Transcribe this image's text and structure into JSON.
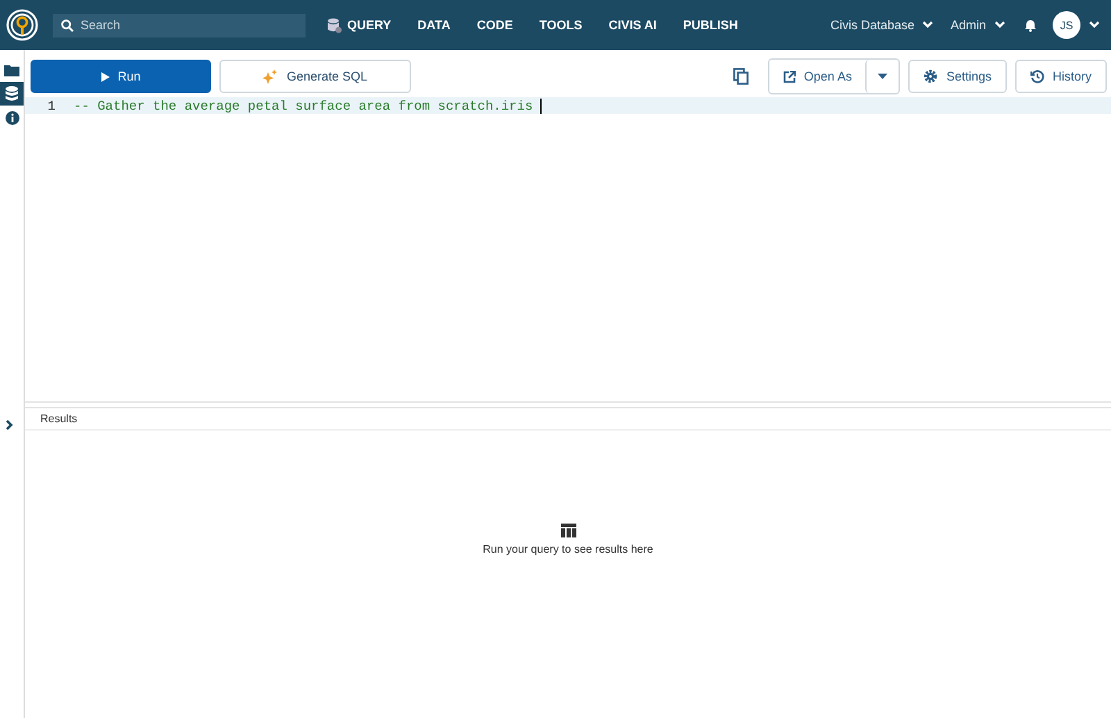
{
  "topbar": {
    "search": {
      "placeholder": "Search"
    },
    "nav": [
      {
        "label": "QUERY",
        "kind": "icon"
      },
      {
        "label": "DATA",
        "kind": "plain"
      },
      {
        "label": "CODE",
        "kind": "plain"
      },
      {
        "label": "TOOLS",
        "kind": "plain"
      },
      {
        "label": "CIVIS AI",
        "kind": "plain"
      },
      {
        "label": "PUBLISH",
        "kind": "plain"
      }
    ],
    "database": "Civis Database",
    "role": "Admin",
    "avatar": "JS"
  },
  "sidebar": {
    "items": [
      {
        "kind": "folder",
        "selected": false
      },
      {
        "kind": "database",
        "selected": true
      },
      {
        "kind": "info",
        "selected": false
      }
    ]
  },
  "toolbar": {
    "run": "Run",
    "generate": "Generate SQL",
    "open_as": "Open As",
    "settings": "Settings",
    "history": "History"
  },
  "editor": {
    "lines": [
      {
        "number": "1",
        "text": "-- Gather the average petal surface area from scratch.iris"
      }
    ]
  },
  "results": {
    "title": "Results",
    "empty": "Run your query to see results here"
  }
}
